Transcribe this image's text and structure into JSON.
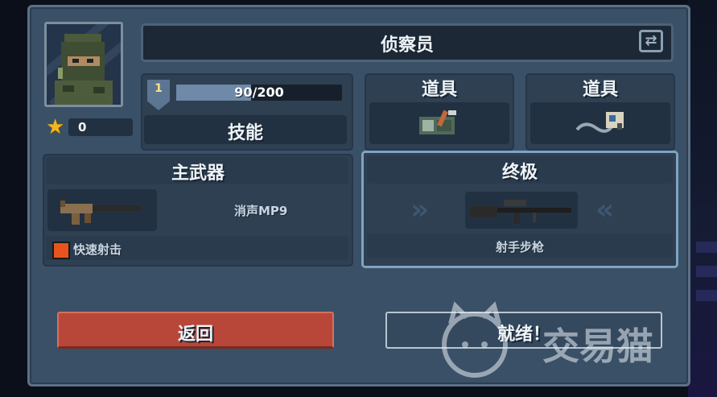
{
  "character": {
    "name": "侦察员",
    "stars": "0",
    "level": "1",
    "xp_text": "90/200",
    "xp_fraction": 0.45,
    "skill_label": "技能"
  },
  "items": [
    {
      "label": "道具",
      "icon": "grenade-pouch-icon"
    },
    {
      "label": "道具",
      "icon": "detonator-icon"
    }
  ],
  "primary_weapon": {
    "title": "主武器",
    "name": "消声MP9",
    "perk": "快速射击",
    "icon": "smg-icon"
  },
  "ultimate": {
    "title": "终极",
    "name": "射手步枪",
    "icon": "sniper-rifle-icon"
  },
  "buttons": {
    "back": "返回",
    "ready": "就绪！"
  },
  "watermark": "交易猫",
  "colors": {
    "panel": "#3a5066",
    "back_button": "#b8473a",
    "star": "#f2b51f",
    "ultimate_border": "#7fa3c2"
  }
}
